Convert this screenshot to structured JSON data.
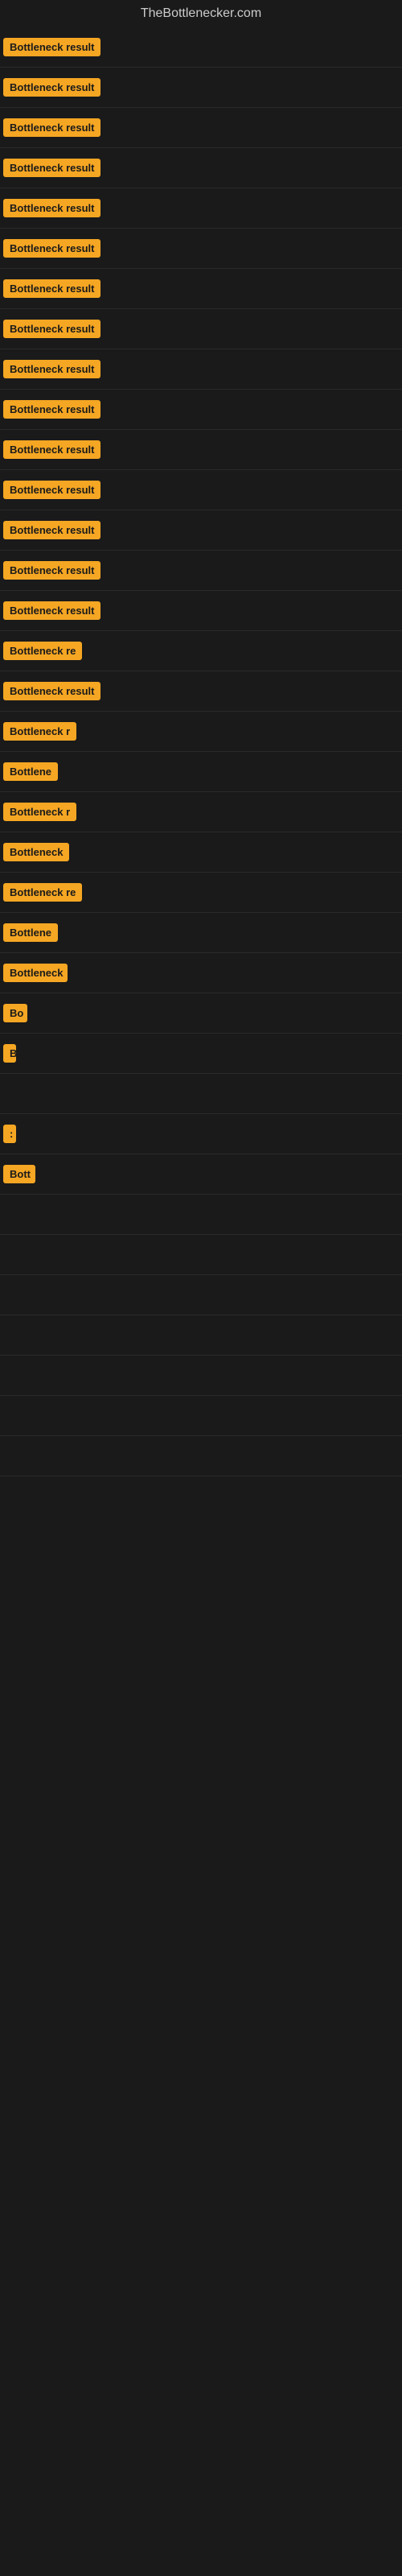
{
  "site": {
    "title": "TheBottlenecker.com"
  },
  "rows": [
    {
      "id": 1,
      "label": "Bottleneck result",
      "width": 140
    },
    {
      "id": 2,
      "label": "Bottleneck result",
      "width": 140
    },
    {
      "id": 3,
      "label": "Bottleneck result",
      "width": 140
    },
    {
      "id": 4,
      "label": "Bottleneck result",
      "width": 140
    },
    {
      "id": 5,
      "label": "Bottleneck result",
      "width": 140
    },
    {
      "id": 6,
      "label": "Bottleneck result",
      "width": 140
    },
    {
      "id": 7,
      "label": "Bottleneck result",
      "width": 140
    },
    {
      "id": 8,
      "label": "Bottleneck result",
      "width": 140
    },
    {
      "id": 9,
      "label": "Bottleneck result",
      "width": 140
    },
    {
      "id": 10,
      "label": "Bottleneck result",
      "width": 140
    },
    {
      "id": 11,
      "label": "Bottleneck result",
      "width": 140
    },
    {
      "id": 12,
      "label": "Bottleneck result",
      "width": 140
    },
    {
      "id": 13,
      "label": "Bottleneck result",
      "width": 140
    },
    {
      "id": 14,
      "label": "Bottleneck result",
      "width": 140
    },
    {
      "id": 15,
      "label": "Bottleneck result",
      "width": 140
    },
    {
      "id": 16,
      "label": "Bottleneck re",
      "width": 110
    },
    {
      "id": 17,
      "label": "Bottleneck result",
      "width": 130
    },
    {
      "id": 18,
      "label": "Bottleneck r",
      "width": 100
    },
    {
      "id": 19,
      "label": "Bottlene",
      "width": 80
    },
    {
      "id": 20,
      "label": "Bottleneck r",
      "width": 95
    },
    {
      "id": 21,
      "label": "Bottleneck",
      "width": 85
    },
    {
      "id": 22,
      "label": "Bottleneck re",
      "width": 105
    },
    {
      "id": 23,
      "label": "Bottlene",
      "width": 75
    },
    {
      "id": 24,
      "label": "Bottleneck",
      "width": 80
    },
    {
      "id": 25,
      "label": "Bo",
      "width": 30
    },
    {
      "id": 26,
      "label": "B",
      "width": 15
    },
    {
      "id": 27,
      "label": "",
      "width": 0
    },
    {
      "id": 28,
      "label": ":",
      "width": 10
    },
    {
      "id": 29,
      "label": "Bott",
      "width": 40
    },
    {
      "id": 30,
      "label": "",
      "width": 0
    },
    {
      "id": 31,
      "label": "",
      "width": 0
    },
    {
      "id": 32,
      "label": "",
      "width": 0
    },
    {
      "id": 33,
      "label": "",
      "width": 0
    },
    {
      "id": 34,
      "label": "",
      "width": 0
    },
    {
      "id": 35,
      "label": "",
      "width": 0
    },
    {
      "id": 36,
      "label": "",
      "width": 0
    }
  ]
}
